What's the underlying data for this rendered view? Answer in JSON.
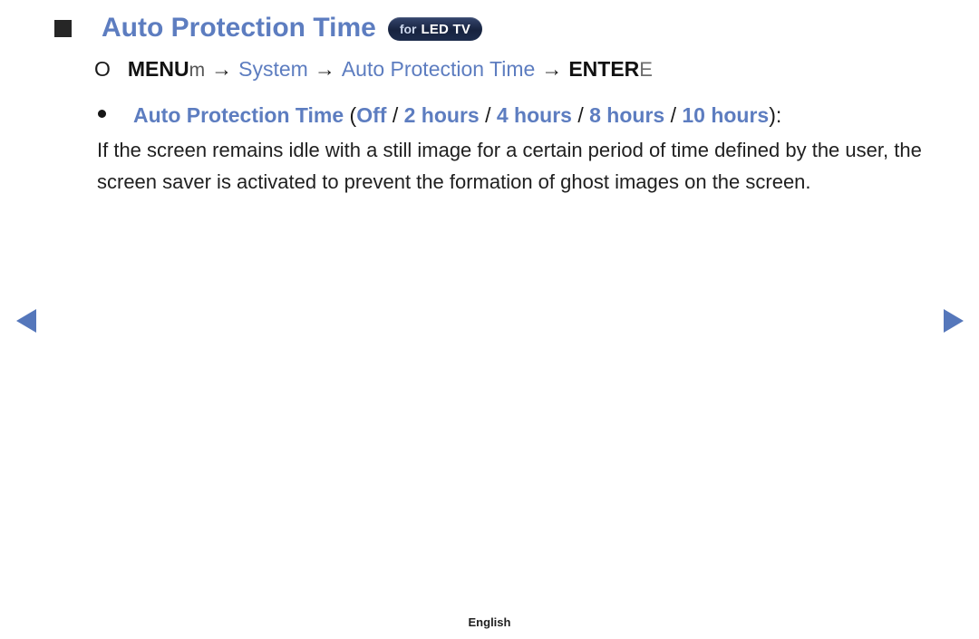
{
  "title": {
    "heading": "Auto Protection Time",
    "badge_prefix": "for",
    "badge_model": "LED TV",
    "marker_icon": "black-square-icon"
  },
  "menu_path": {
    "lead_glyph": "O",
    "menu_label": "MENU",
    "menu_key_glyph": "m",
    "arrow": "→",
    "step_system": "System",
    "step_feature": "Auto Protection Time",
    "enter_label": "ENTER",
    "enter_key_glyph": "E"
  },
  "option_line": {
    "bullet_icon": "round-dot-icon",
    "label": "Auto Protection Time",
    "open_paren": "(",
    "close_paren": ")",
    "separator": "/",
    "colon": ":",
    "options": [
      "Off",
      "2 hours",
      "4 hours",
      "8 hours",
      "10 hours"
    ]
  },
  "body": {
    "paragraph": "If the screen remains idle with a still image for a certain period of time defined by the user, the screen saver is activated to prevent the formation of ghost images on the screen."
  },
  "navigation": {
    "prev_icon": "triangle-left-icon",
    "next_icon": "triangle-right-icon"
  },
  "footer": {
    "language": "English"
  },
  "colors": {
    "accent_blue": "#5d7dc0",
    "arrow_blue": "#5577bb",
    "badge_dark": "#1d2c4c",
    "text_black": "#1a1a1a"
  }
}
